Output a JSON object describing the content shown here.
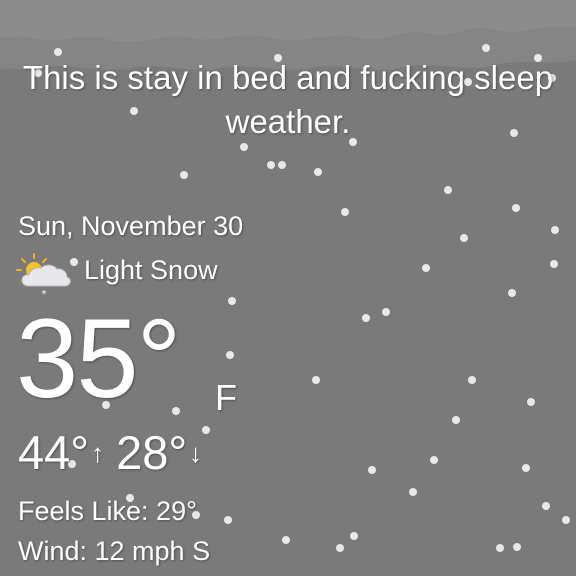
{
  "headline": "This is stay in bed and fucking sleep weather.",
  "date": "Sun, November 30",
  "condition": {
    "icon": "partly-sunny-snow-icon",
    "text": "Light Snow"
  },
  "temperature": {
    "value": "35°",
    "unit": "F"
  },
  "high_low": {
    "high": "44°",
    "high_arrow": "↑",
    "low": "28°",
    "low_arrow": "↓"
  },
  "feels_like": "Feels Like:  29°",
  "wind": "Wind:  12 mph S",
  "colors": {
    "background": "#7a7a7a",
    "cloud": "#8c8c8c",
    "text": "#ffffff"
  }
}
